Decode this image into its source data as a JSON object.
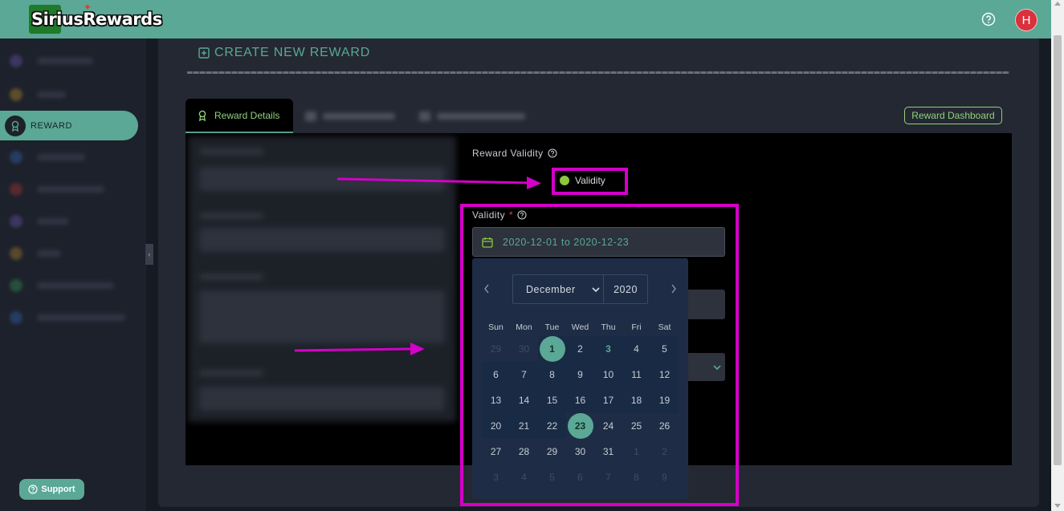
{
  "app": {
    "brand": "SiriusRewards",
    "avatar_initial": "H"
  },
  "sidebar": {
    "active_label": "REWARD",
    "support_label": "Support"
  },
  "main": {
    "page_title": "CREATE NEW REWARD",
    "tabs": [
      {
        "label": "Reward Details",
        "active": true
      }
    ],
    "reward_dashboard_label": "Reward Dashboard",
    "reward_validity_label": "Reward Validity",
    "validity_option_label": "Validity",
    "validity_field_label": "Validity",
    "required_marker": "*",
    "date_range_value": "2020-12-01 to 2020-12-23"
  },
  "calendar": {
    "month": "December",
    "year": "2020",
    "weekdays": [
      "Sun",
      "Mon",
      "Tue",
      "Wed",
      "Thu",
      "Fri",
      "Sat"
    ],
    "weeks": [
      [
        "29",
        "30",
        "1",
        "2",
        "3",
        "4",
        "5"
      ],
      [
        "6",
        "7",
        "8",
        "9",
        "10",
        "11",
        "12"
      ],
      [
        "13",
        "14",
        "15",
        "16",
        "17",
        "18",
        "19"
      ],
      [
        "20",
        "21",
        "22",
        "23",
        "24",
        "25",
        "26"
      ],
      [
        "27",
        "28",
        "29",
        "30",
        "31",
        "1",
        "2"
      ],
      [
        "3",
        "4",
        "5",
        "6",
        "7",
        "8",
        "9"
      ]
    ]
  },
  "colors": {
    "accent": "#5aa895",
    "highlight": "#d400c8",
    "green_text": "#8fd27a",
    "calendar_bg": "#1e2d45"
  },
  "icons": [
    "help-icon",
    "award-icon",
    "plus-square-icon",
    "calendar-icon",
    "chevron-left-icon",
    "chevron-right-icon",
    "chevron-down-icon",
    "question-circle-icon"
  ]
}
